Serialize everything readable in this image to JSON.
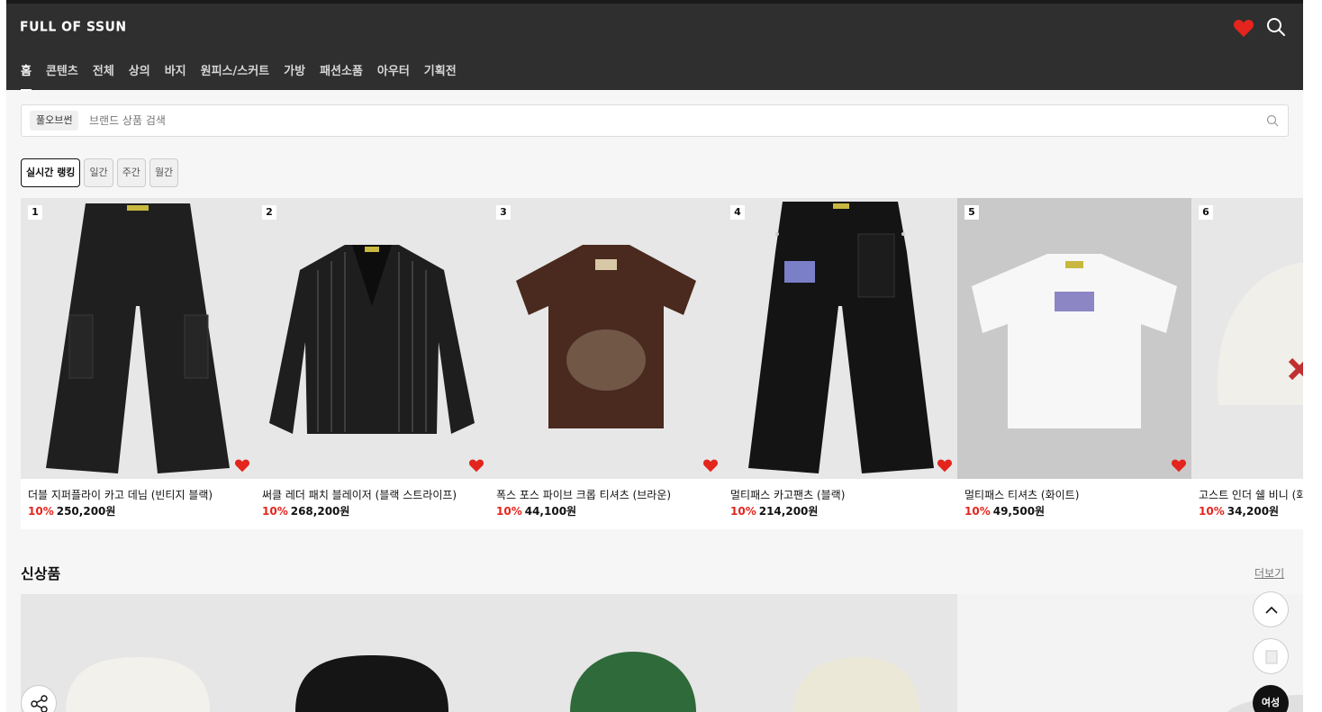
{
  "header": {
    "logo": "FULL OF SSUN",
    "nav": [
      "홈",
      "콘텐츠",
      "전체",
      "상의",
      "바지",
      "원피스/스커트",
      "가방",
      "패션소품",
      "아우터",
      "기획전"
    ]
  },
  "search": {
    "chip": "풀오브썬",
    "placeholder": "브랜드 상품 검색"
  },
  "ranking": {
    "tabs": [
      "실시간 랭킹",
      "일간",
      "주간",
      "월간"
    ],
    "items": [
      {
        "rank": "1",
        "name": "더블 지퍼플라이 카고 데님 (빈티지 블랙)",
        "discount": "10%",
        "price": "250,200원"
      },
      {
        "rank": "2",
        "name": "써클 레더 패치 블레이저 (블랙 스트라이프)",
        "discount": "10%",
        "price": "268,200원"
      },
      {
        "rank": "3",
        "name": "폭스 포스 파이브 크롭 티셔츠 (브라운)",
        "discount": "10%",
        "price": "44,100원"
      },
      {
        "rank": "4",
        "name": "멀티패스 카고팬츠 (블랙)",
        "discount": "10%",
        "price": "214,200원"
      },
      {
        "rank": "5",
        "name": "멀티패스 티셔츠 (화이트)",
        "discount": "10%",
        "price": "49,500원"
      },
      {
        "rank": "6",
        "name": "고스트 인더 쉘 비니 (화",
        "discount": "10%",
        "price": "34,200원"
      }
    ]
  },
  "new_section": {
    "title": "신상품",
    "more": "더보기"
  },
  "floating": {
    "gender_label": "여성"
  },
  "colors": {
    "header_bg": "#2f2f2f",
    "accent_red": "#e3251e"
  }
}
